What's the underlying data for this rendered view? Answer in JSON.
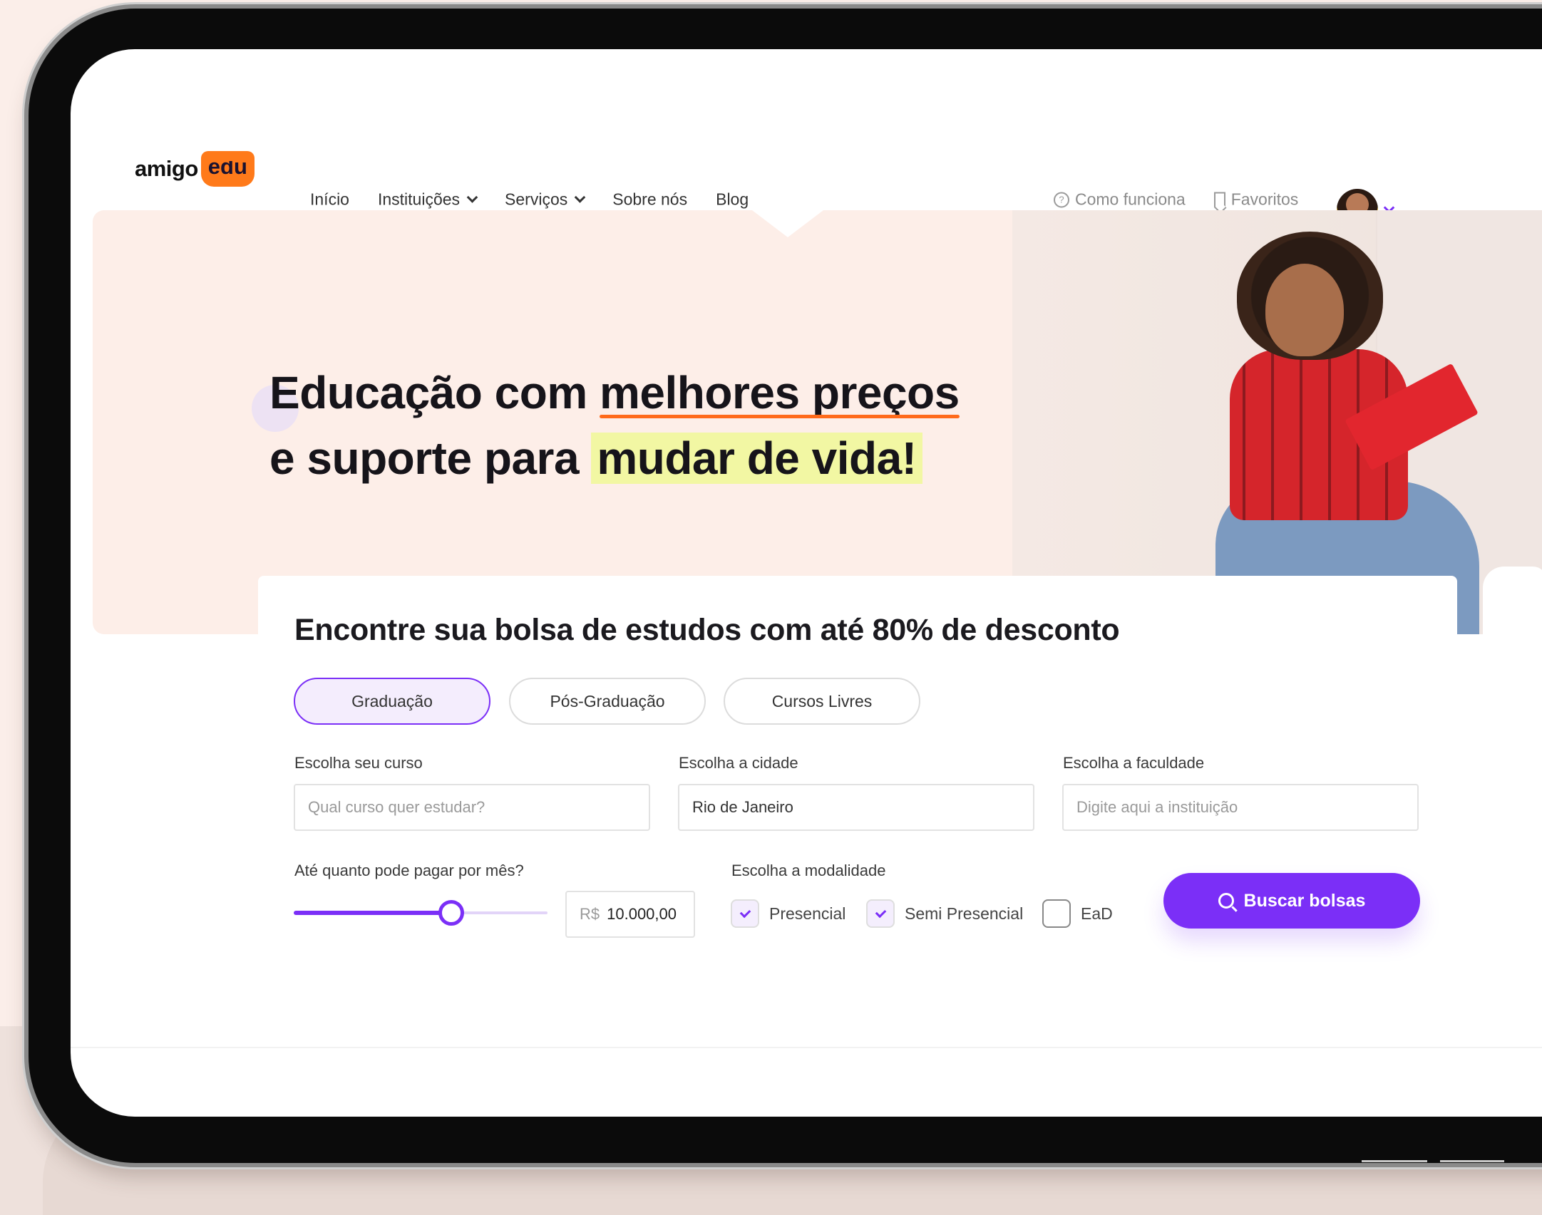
{
  "header": {
    "logo": {
      "part1": "amigo",
      "part2": "edu"
    },
    "nav": [
      {
        "label": "Início",
        "has_dropdown": false
      },
      {
        "label": "Instituições",
        "has_dropdown": true
      },
      {
        "label": "Serviços",
        "has_dropdown": true
      },
      {
        "label": "Sobre nós",
        "has_dropdown": false
      },
      {
        "label": "Blog",
        "has_dropdown": false
      }
    ],
    "how_it_works": "Como funciona",
    "favorites": "Favoritos"
  },
  "hero": {
    "line1_prefix": "Educação com ",
    "line1_highlight": "melhores preços",
    "line2_prefix": "e suporte para ",
    "line2_highlight": "mudar de vida!"
  },
  "search": {
    "title": "Encontre sua bolsa de estudos com até 80% de desconto",
    "tabs": [
      {
        "label": "Graduação",
        "active": true
      },
      {
        "label": "Pós-Graduação",
        "active": false
      },
      {
        "label": "Cursos Livres",
        "active": false
      }
    ],
    "course": {
      "label": "Escolha seu curso",
      "placeholder": "Qual curso quer estudar?",
      "value": ""
    },
    "city": {
      "label": "Escolha a cidade",
      "value": "Rio de Janeiro"
    },
    "college": {
      "label": "Escolha a faculdade",
      "placeholder": "Digite aqui a instituição",
      "value": ""
    },
    "price": {
      "label": "Até quanto pode pagar por mês?",
      "currency": "R$",
      "value": "10.000,00",
      "slider_fraction": 0.62
    },
    "modality": {
      "label": "Escolha a modalidade",
      "options": [
        {
          "label": "Presencial",
          "checked": true
        },
        {
          "label": "Semi Presencial",
          "checked": true
        },
        {
          "label": "EaD",
          "checked": false
        }
      ]
    },
    "submit_label": "Buscar bolsas"
  },
  "colors": {
    "primary": "#7b2ff7",
    "brand_orange": "#ff7a1a",
    "highlight_yellow": "#f2f7a3",
    "hero_bg": "#fdeee8"
  }
}
